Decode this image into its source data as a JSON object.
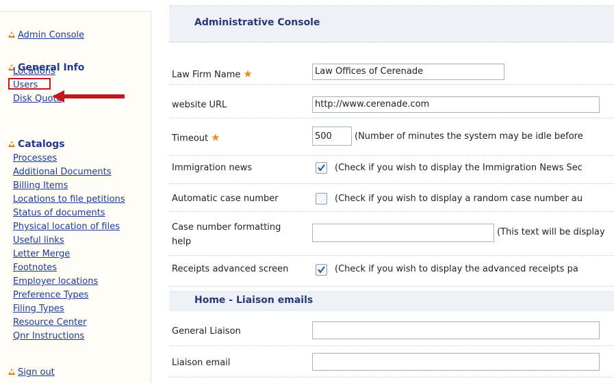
{
  "sidebar": {
    "admin_console": "Admin Console",
    "general_info": {
      "heading": "General Info",
      "items": [
        "Locations",
        "Users",
        "Disk Quota"
      ]
    },
    "catalogs": {
      "heading": "Catalogs",
      "items": [
        "Processes",
        "Additional Documents",
        "Billing Items",
        "Locations to file petitions",
        "Status of documents",
        "Physical location of files",
        "Useful links",
        "Letter Merge",
        "Footnotes",
        "Employer locations",
        "Preference Types",
        "Filing Types",
        "Resource Center",
        "Qnr Instructions"
      ]
    },
    "sign_out": "Sign out"
  },
  "main": {
    "title": "Administrative Console",
    "fields": {
      "law_firm_name": {
        "label": "Law Firm Name",
        "value": "Law Offices of Cerenade"
      },
      "website_url": {
        "label": "website URL",
        "value": "http://www.cerenade.com"
      },
      "timeout": {
        "label": "Timeout",
        "value": "500",
        "hint": "(Number of minutes the system may be idle before"
      },
      "immigration_news": {
        "label": "Immigration news",
        "checked": true,
        "hint": "(Check if you wish to display the Immigration News Sec"
      },
      "auto_case_number": {
        "label": "Automatic case number",
        "checked": false,
        "hint": "(Check if you wish to display a random case number au"
      },
      "case_number_help": {
        "label_line1": "Case number formatting",
        "label_line2": "help",
        "value": "",
        "hint": "(This text will be display"
      },
      "receipts_advanced": {
        "label": "Receipts advanced screen",
        "checked": true,
        "hint": "(Check if you wish to display the advanced receipts pa"
      }
    },
    "home_section": {
      "title": "Home - Liaison emails",
      "general_liaison": {
        "label": "General Liaison",
        "value": ""
      },
      "liaison_email": {
        "label": "Liaison email",
        "value": ""
      }
    }
  },
  "colors": {
    "accent_orange": "#f08a1c",
    "link_blue": "#1a3a9c",
    "heading_blue": "#27397a",
    "highlight_red": "#c4161c"
  }
}
